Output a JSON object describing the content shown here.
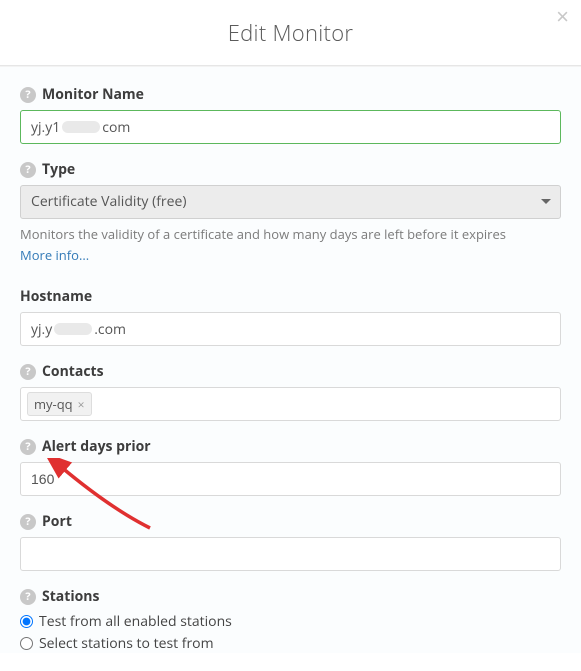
{
  "header": {
    "title": "Edit Monitor"
  },
  "form": {
    "monitor_name": {
      "label": "Monitor Name",
      "value_prefix": "yj.y1",
      "value_suffix": "com"
    },
    "type": {
      "label": "Type",
      "selected": "Certificate Validity (free)",
      "help_text": "Monitors the validity of a certificate and how many days are left before it expires",
      "more_link": "More info..."
    },
    "hostname": {
      "label": "Hostname",
      "value_prefix": "yj.y",
      "value_suffix": ".com"
    },
    "contacts": {
      "label": "Contacts",
      "tags": [
        "my-qq"
      ]
    },
    "alert_days": {
      "label": "Alert days prior",
      "value": "160"
    },
    "port": {
      "label": "Port",
      "value": ""
    },
    "stations": {
      "label": "Stations",
      "option_all": "Test from all enabled stations",
      "option_select": "Select stations to test from",
      "checked": "all"
    }
  }
}
